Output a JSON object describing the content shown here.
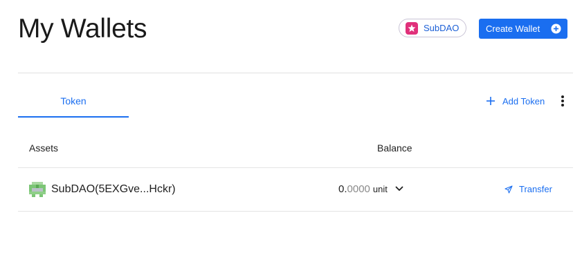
{
  "header": {
    "title": "My Wallets",
    "network_label": "SubDAO",
    "create_wallet_label": "Create Wallet"
  },
  "tabs": [
    {
      "label": "Token",
      "active": true
    }
  ],
  "toolbar": {
    "add_token_label": "Add Token"
  },
  "table": {
    "columns": [
      "Assets",
      "Balance"
    ],
    "rows": [
      {
        "asset": "SubDAO(5EXGve...Hckr)",
        "balance_integer": "0.",
        "balance_decimal": "0000",
        "unit": "unit",
        "action": "Transfer"
      }
    ]
  },
  "colors": {
    "primary": "#1a6ef0",
    "brand_pink": "#e0307a",
    "avatar_green": "#7cc576"
  },
  "icons": {
    "network": "star-logo-icon",
    "create": "plus-circle-icon",
    "add": "plus-icon",
    "more": "kebab-menu-icon",
    "expand": "chevron-down-icon",
    "transfer": "send-icon",
    "asset": "identicon-avatar"
  }
}
